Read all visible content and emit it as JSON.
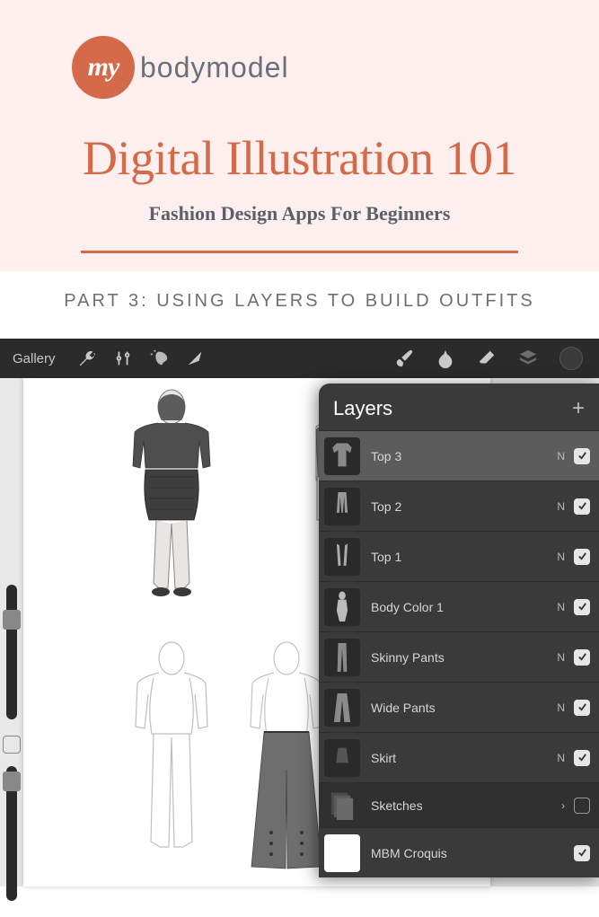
{
  "logo": {
    "my": "my",
    "rest": "bodymodel"
  },
  "header": {
    "title": "Digital Illustration 101",
    "subtitle": "Fashion Design Apps For Beginners",
    "part": "PART 3: USING LAYERS TO BUILD OUTFITS"
  },
  "toolbar": {
    "gallery": "Gallery"
  },
  "layers_panel": {
    "title": "Layers"
  },
  "layers": [
    {
      "name": "Top 3",
      "blend": "N",
      "checked": true,
      "selected": true,
      "kind": "item"
    },
    {
      "name": "Top 2",
      "blend": "N",
      "checked": true,
      "selected": false,
      "kind": "item"
    },
    {
      "name": "Top 1",
      "blend": "N",
      "checked": true,
      "selected": false,
      "kind": "item"
    },
    {
      "name": "Body Color 1",
      "blend": "N",
      "checked": true,
      "selected": false,
      "kind": "item"
    },
    {
      "name": "Skinny Pants",
      "blend": "N",
      "checked": true,
      "selected": false,
      "kind": "item"
    },
    {
      "name": "Wide Pants",
      "blend": "N",
      "checked": true,
      "selected": false,
      "kind": "item"
    },
    {
      "name": "Skirt",
      "blend": "N",
      "checked": true,
      "selected": false,
      "kind": "item"
    },
    {
      "name": "Sketches",
      "blend": "›",
      "checked": false,
      "selected": false,
      "kind": "group"
    },
    {
      "name": "MBM Croquis",
      "blend": "",
      "checked": true,
      "selected": false,
      "kind": "white"
    }
  ]
}
